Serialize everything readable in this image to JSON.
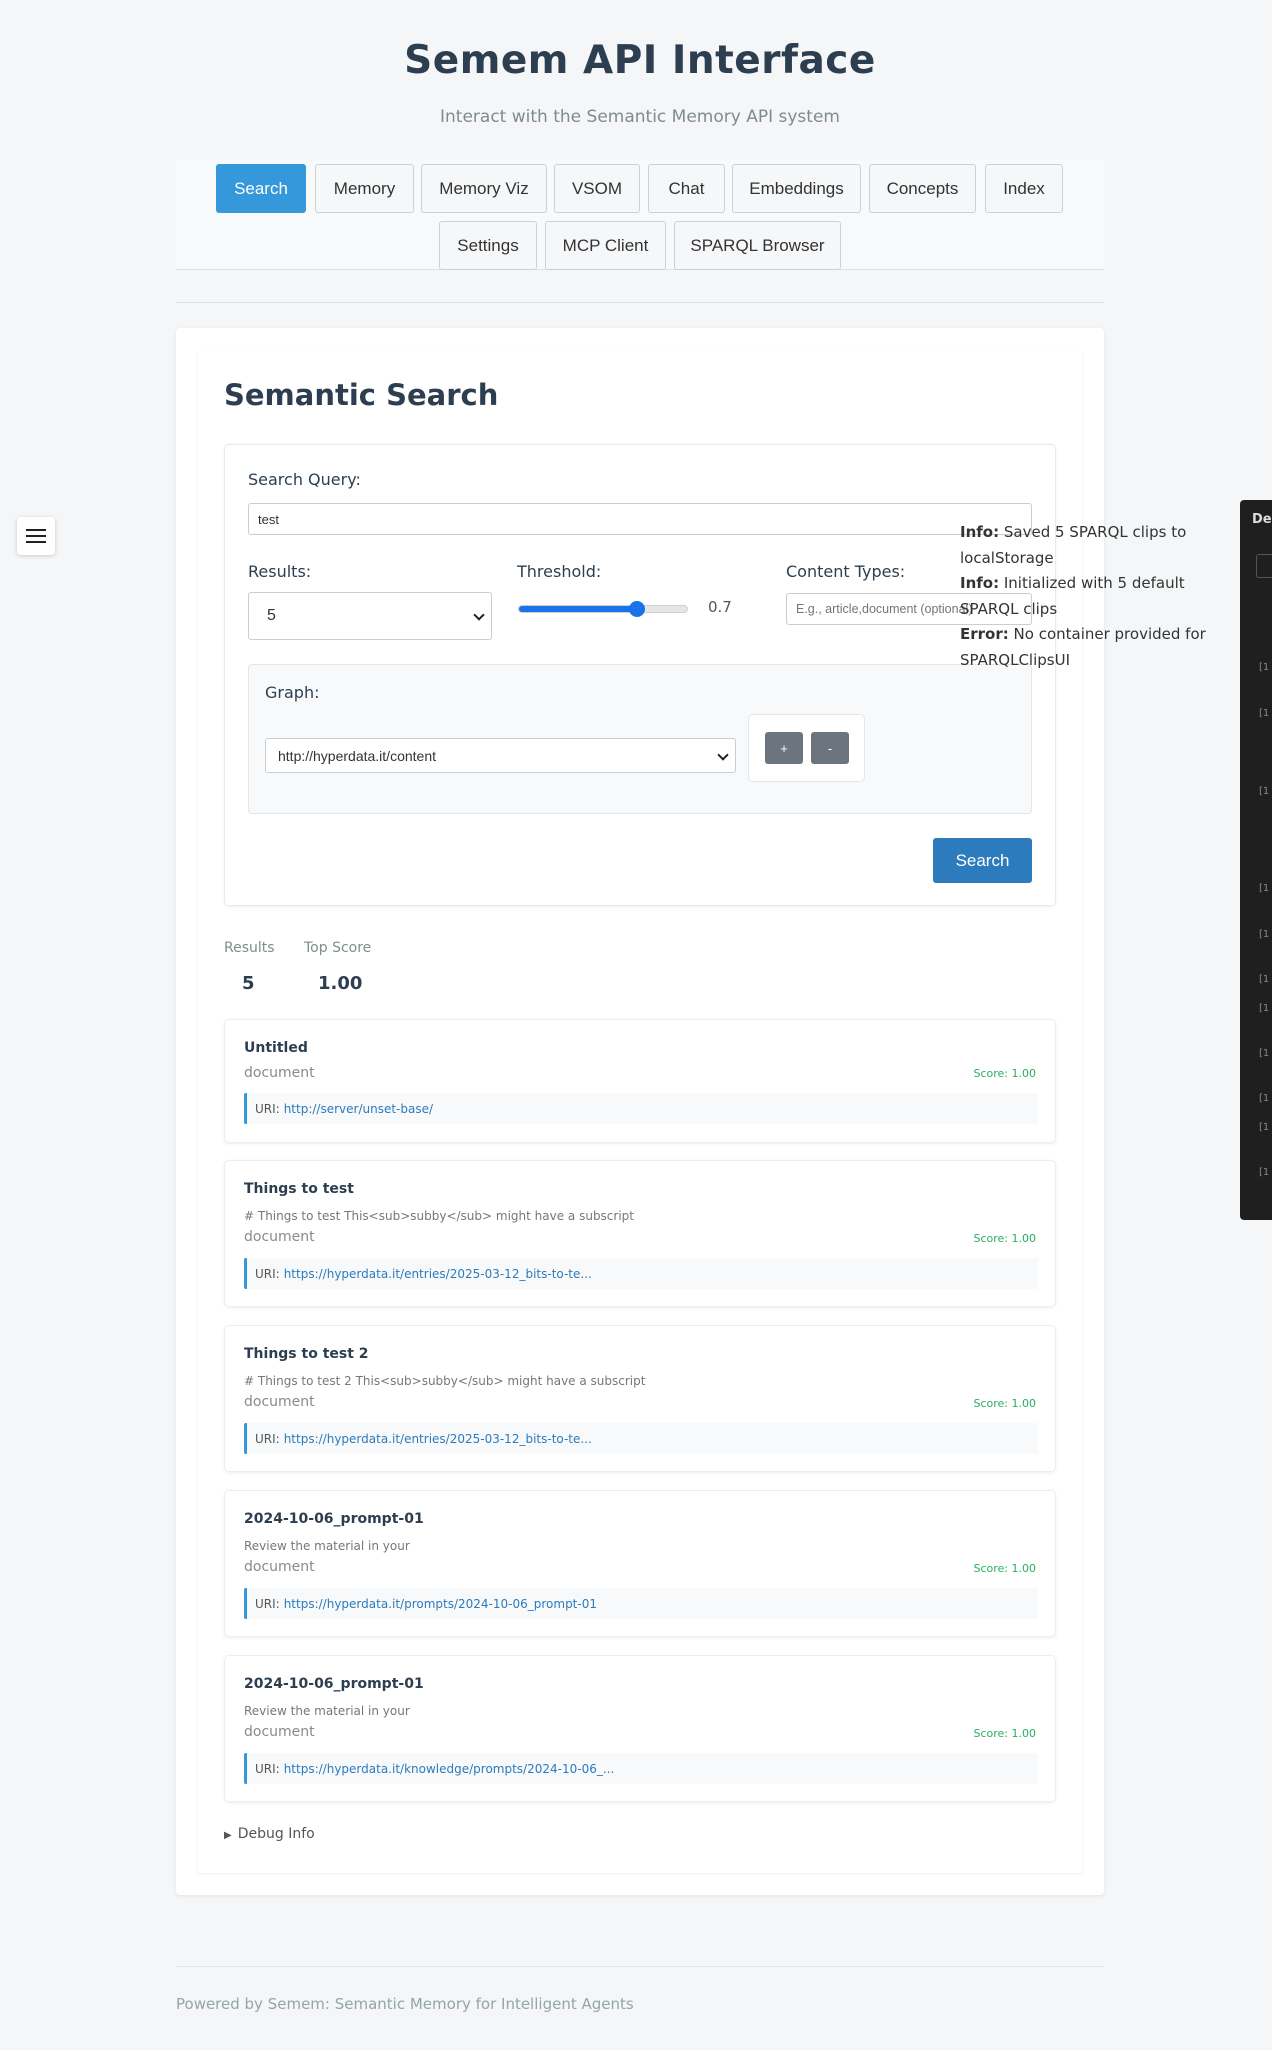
{
  "header": {
    "title": "Semem API Interface",
    "subtitle": "Interact with the Semantic Memory API system"
  },
  "tabs": [
    {
      "label": "Search",
      "active": true
    },
    {
      "label": "Memory"
    },
    {
      "label": "Memory Viz"
    },
    {
      "label": "VSOM"
    },
    {
      "label": "Chat"
    },
    {
      "label": "Embeddings"
    },
    {
      "label": "Concepts"
    },
    {
      "label": "Index"
    },
    {
      "label": "Settings"
    },
    {
      "label": "MCP Client"
    },
    {
      "label": "SPARQL Browser"
    }
  ],
  "search": {
    "title": "Semantic Search",
    "query_label": "Search Query:",
    "query_value": "test",
    "results_label": "Results:",
    "results_value": "5",
    "threshold_label": "Threshold:",
    "threshold_value": "0.7",
    "threshold_fraction": 0.7,
    "content_types_label": "Content Types:",
    "content_types_placeholder": "E.g., article,document (optional)",
    "graph_label": "Graph:",
    "graph_value": "http://hyperdata.it/content",
    "graph_add": "+",
    "graph_remove": "-",
    "search_button": "Search"
  },
  "stats": {
    "results_label": "Results",
    "results_value": "5",
    "top_score_label": "Top Score",
    "top_score_value": "1.00"
  },
  "results": [
    {
      "title": "Untitled",
      "snippet": "",
      "type": "document",
      "score": "Score: 1.00",
      "uri_label": "URI:",
      "uri": "http://server/unset-base/"
    },
    {
      "title": "Things to test",
      "snippet": "# Things to test This<sub>subby</sub> might have a subscript",
      "type": "document",
      "score": "Score: 1.00",
      "uri_label": "URI:",
      "uri": "https://hyperdata.it/entries/2025-03-12_bits-to-te..."
    },
    {
      "title": "Things to test 2",
      "snippet": "# Things to test 2 This<sub>subby</sub> might have a subscript",
      "type": "document",
      "score": "Score: 1.00",
      "uri_label": "URI:",
      "uri": "https://hyperdata.it/entries/2025-03-12_bits-to-te..."
    },
    {
      "title": "2024-10-06_prompt-01",
      "snippet": "Review the material in your",
      "type": "document",
      "score": "Score: 1.00",
      "uri_label": "URI:",
      "uri": "https://hyperdata.it/prompts/2024-10-06_prompt-01"
    },
    {
      "title": "2024-10-06_prompt-01",
      "snippet": "Review the material in your",
      "type": "document",
      "score": "Score: 1.00",
      "uri_label": "URI:",
      "uri": "https://hyperdata.it/knowledge/prompts/2024-10-06_..."
    }
  ],
  "debug": {
    "label": "Debug Info"
  },
  "footer": {
    "text": "Powered by Semem: Semantic Memory for Intelligent Agents"
  },
  "log_messages": [
    {
      "level": "Info:",
      "text": "Saved 5 SPARQL clips to localStorage"
    },
    {
      "level": "Info:",
      "text": "Initialized with 5 default SPARQL clips"
    },
    {
      "level": "Error:",
      "text": "No container provided for SPARQLClipsUI"
    }
  ],
  "devtools": {
    "title": "Dev",
    "line_marker": "[1"
  },
  "colors": {
    "accent": "#3498db",
    "primary_button": "#2b7bbd",
    "score": "#27ae60",
    "secondary_button": "#6c757d"
  },
  "icons": {
    "menu": "hamburger-icon",
    "dropdown": "chevron-down-icon",
    "debug": "triangle-right-icon"
  }
}
